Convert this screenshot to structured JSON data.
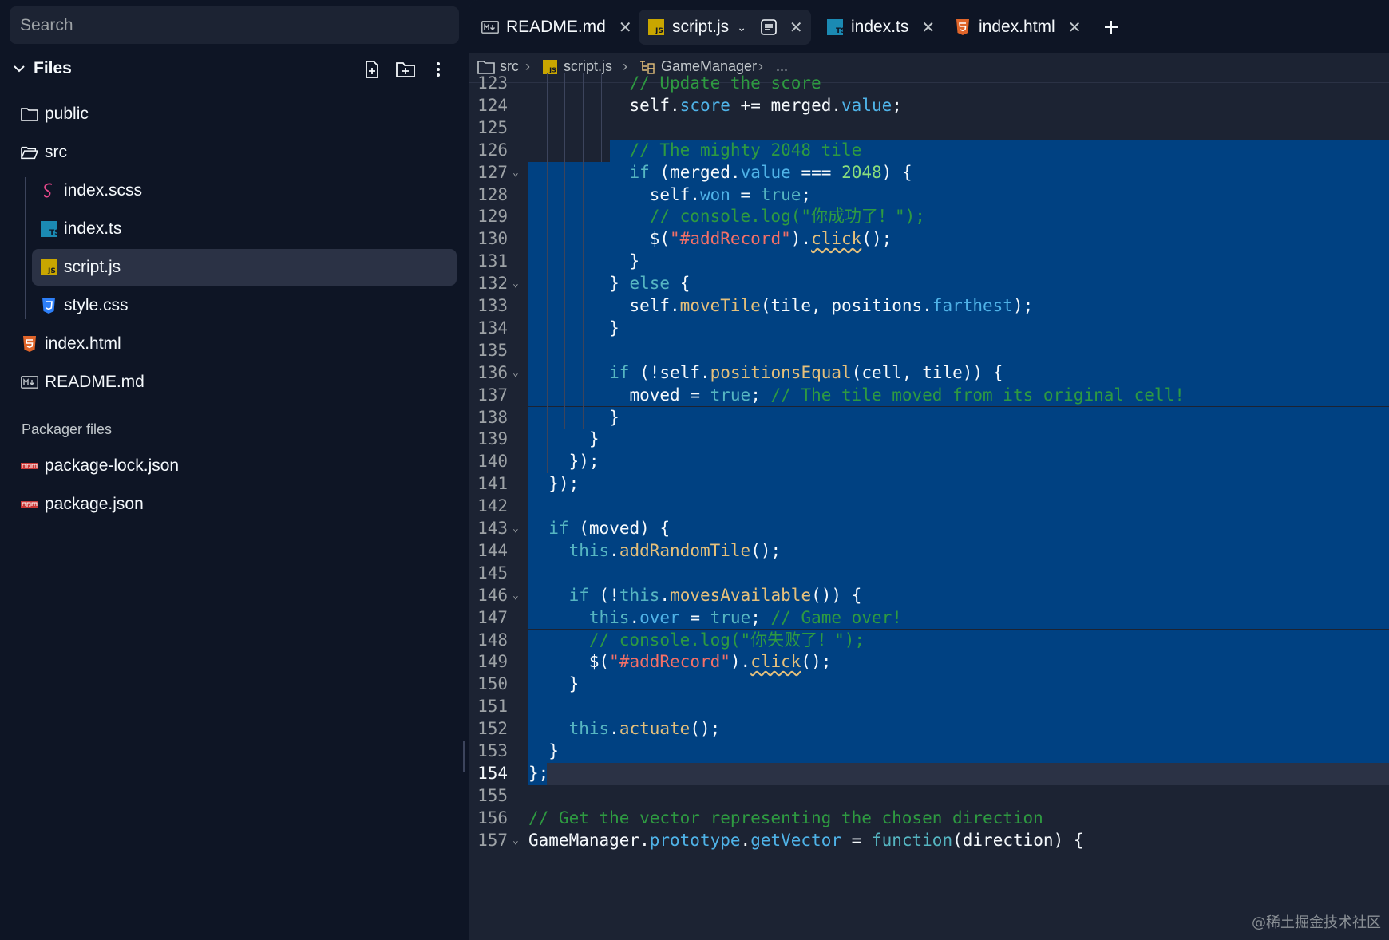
{
  "sidebar": {
    "search_placeholder": "Search",
    "files_title": "Files",
    "tree": [
      {
        "label": "public",
        "icon": "folder-icon"
      },
      {
        "label": "src",
        "icon": "folder-open-icon"
      },
      {
        "label": "index.scss",
        "icon": "sass-icon"
      },
      {
        "label": "index.ts",
        "icon": "typescript-icon"
      },
      {
        "label": "script.js",
        "icon": "javascript-icon",
        "active": true
      },
      {
        "label": "style.css",
        "icon": "css-icon"
      },
      {
        "label": "index.html",
        "icon": "html-icon"
      },
      {
        "label": "README.md",
        "icon": "markdown-icon"
      }
    ],
    "packager_title": "Packager files",
    "packager_files": [
      {
        "label": "package-lock.json",
        "icon": "npm-icon"
      },
      {
        "label": "package.json",
        "icon": "npm-icon"
      }
    ]
  },
  "tabs": [
    {
      "label": "README.md",
      "icon": "markdown-icon"
    },
    {
      "label": "script.js",
      "icon": "javascript-icon",
      "active": true
    },
    {
      "label": "index.ts",
      "icon": "typescript-icon"
    },
    {
      "label": "index.html",
      "icon": "html-icon"
    }
  ],
  "breadcrumb": {
    "folder": "src",
    "file": "script.js",
    "symbol": "GameManager",
    "more": "..."
  },
  "editor": {
    "first_line": 123,
    "current_line": 154,
    "line_numbers": [
      "123",
      "124",
      "125",
      "126",
      "127",
      "128",
      "129",
      "130",
      "131",
      "132",
      "133",
      "134",
      "135",
      "136",
      "137",
      "138",
      "139",
      "140",
      "141",
      "142",
      "143",
      "144",
      "145",
      "146",
      "147",
      "148",
      "149",
      "150",
      "151",
      "152",
      "153",
      "154",
      "155",
      "156",
      "157"
    ],
    "fold_lines": [
      127,
      132,
      136,
      143,
      146,
      157
    ],
    "code": [
      "          // Update the score",
      "          self.score += merged.value;",
      "",
      "          // The mighty 2048 tile",
      "          if (merged.value === 2048) {",
      "            self.won = true;",
      "            // console.log(\"你成功了！\");",
      "            $(\"#addRecord\").click();",
      "          }",
      "        } else {",
      "          self.moveTile(tile, positions.farthest);",
      "        }",
      "",
      "        if (!self.positionsEqual(cell, tile)) {",
      "          moved = true; // The tile moved from its original cell!",
      "        }",
      "      }",
      "    });",
      "  });",
      "",
      "  if (moved) {",
      "    this.addRandomTile();",
      "",
      "    if (!this.movesAvailable()) {",
      "      this.over = true; // Game over!",
      "      // console.log(\"你失败了！\");",
      "      $(\"#addRecord\").click();",
      "    }",
      "",
      "    this.actuate();",
      "  }",
      "};",
      "",
      "// Get the vector representing the chosen direction",
      "GameManager.prototype.getVector = function(direction) {"
    ]
  },
  "watermark": "@稀土掘金技术社区"
}
